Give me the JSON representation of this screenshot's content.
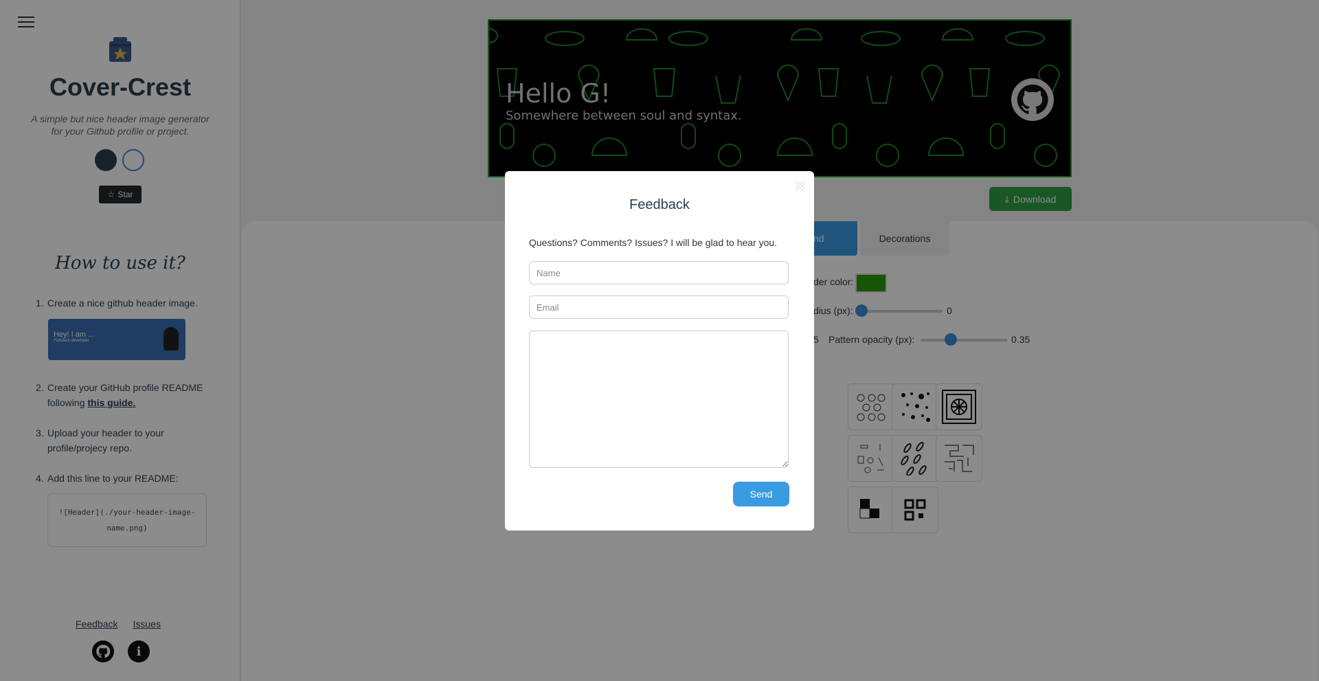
{
  "sidebar": {
    "app_title": "Cover-Crest",
    "app_subtitle": "A simple but nice header image generator for your Github profile or project.",
    "star_label": "Star",
    "how_title": "How to use it?",
    "steps": [
      {
        "num": "1.",
        "text": "Create a nice github header image."
      },
      {
        "num": "2.",
        "text_before": "Create your GitHub profile README following ",
        "link": "this guide."
      },
      {
        "num": "3.",
        "text": "Upload your header to your profile/projecy repo."
      },
      {
        "num": "4.",
        "text": "Add this line to your README:"
      }
    ],
    "preview_card": {
      "title": "Hey! I am ...",
      "subtitle": "Fullstack developer"
    },
    "code_line": "![Header](./your-header-image-name.png)",
    "footer_links": {
      "feedback": "Feedback",
      "issues": "Issues"
    },
    "footer_icons": [
      "github-icon",
      "info-icon"
    ]
  },
  "banner": {
    "title": "Hello G!",
    "subtitle": "Somewhere between soul and syntax.",
    "background_color": "#000000",
    "border_color": "#22a02a",
    "pattern": "food-icons"
  },
  "toolbar": {
    "download_label": "Download"
  },
  "tabs": [
    {
      "label": "Background",
      "visible_label": "ound",
      "active": true
    },
    {
      "label": "Decorations",
      "active": false
    }
  ],
  "controls": {
    "border_color_label": "der color:",
    "border_color": "#2a9a06",
    "radius_label": "dius (px):",
    "radius_value": "0",
    "partial_value": "5",
    "pattern_opacity_label": "Pattern opacity (px):",
    "pattern_opacity_value": "0.35",
    "pattern_opacity_fraction": 0.35
  },
  "modal": {
    "title": "Feedback",
    "close_label": "×",
    "description": "Questions? Comments? Issues? I will be glad to hear you.",
    "name_placeholder": "Name",
    "email_placeholder": "Email",
    "message_value": "",
    "send_label": "Send"
  }
}
